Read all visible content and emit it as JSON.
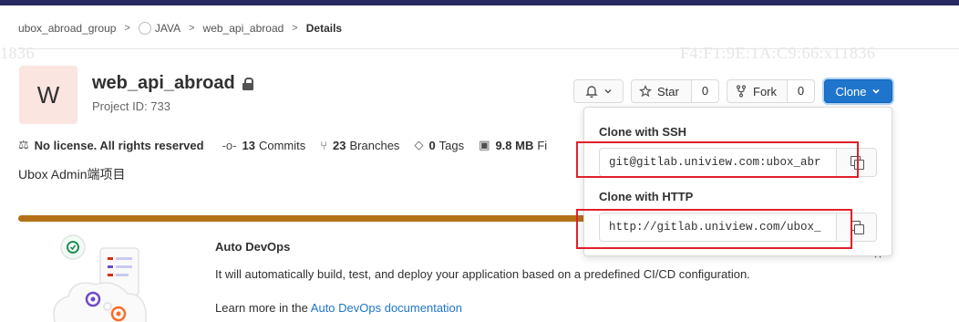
{
  "breadcrumb": {
    "group": "ubox_abroad_group",
    "subgroup": "JAVA",
    "project": "web_api_abroad",
    "current": "Details"
  },
  "watermark": {
    "left": "1836",
    "right": "F4:F1:9E:1A:C9:66:x11836"
  },
  "project": {
    "avatar_letter": "W",
    "name": "web_api_abroad",
    "id_label": "Project ID: 733",
    "description": "Ubox Admin端项目"
  },
  "actions": {
    "notification_icon": "bell-icon",
    "star_label": "Star",
    "star_count": "0",
    "fork_label": "Fork",
    "fork_count": "0",
    "clone_label": "Clone"
  },
  "stats": {
    "license": "No license. All rights reserved",
    "commits_count": "13",
    "commits_label": "Commits",
    "branches_count": "23",
    "branches_label": "Branches",
    "tags_count": "0",
    "tags_label": "Tags",
    "size_value": "9.8 MB",
    "size_label": "Fi"
  },
  "clone": {
    "ssh_label": "Clone with SSH",
    "ssh_url": "git@gitlab.uniview.com:ubox_abr",
    "http_label": "Clone with HTTP",
    "http_url": "http://gitlab.uniview.com/ubox_"
  },
  "auto_devops": {
    "title": "Auto DevOps",
    "text": "It will automatically build, test, and deploy your application based on a predefined CI/CD configuration.",
    "learn_prefix": "Learn more in the ",
    "learn_link": "Auto DevOps documentation"
  },
  "colors": {
    "topbar": "#292961",
    "primary": "#1f75cb",
    "progress": "#ab6100",
    "highlight": "#e0202a",
    "avatar_bg": "#fbe5e1"
  }
}
